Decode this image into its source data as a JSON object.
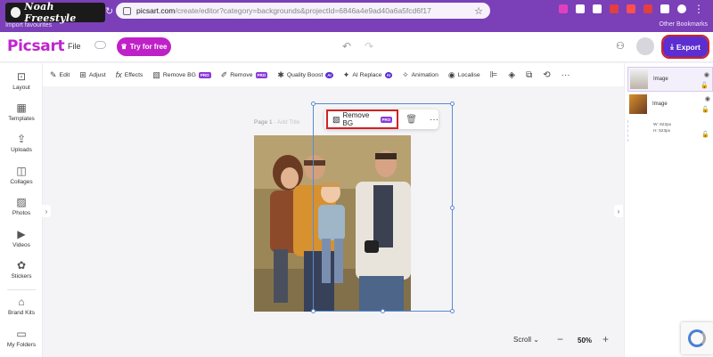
{
  "browser": {
    "brand_logo_text": "Noah Freestyle",
    "import_text": "Import favourites",
    "url_host": "picsart.com",
    "url_path": "/create/editor?category=backgrounds&projectId=6846a4e9ad40a6a5fcd6f17",
    "other_bookmarks": "Other Bookmarks",
    "extension_colors": [
      "#e040c0",
      "#ffffff",
      "#ffffff",
      "#e04040",
      "#ff5050",
      "#e04040",
      "#ffffff",
      "#ffffff"
    ]
  },
  "header": {
    "logo": "Picsart",
    "file_label": "File",
    "try_label": "Try for free",
    "export_label": "Export",
    "accent": "#5b2ed1",
    "brand_pink": "#c020c8"
  },
  "toolbar": {
    "items": [
      {
        "icon": "edit-icon",
        "glyph": "✎",
        "label": "Edit"
      },
      {
        "icon": "adjust-icon",
        "glyph": "⊞",
        "label": "Adjust"
      },
      {
        "icon": "effects-icon",
        "glyph": "fx",
        "label": "Effects"
      },
      {
        "icon": "remove-bg-icon",
        "glyph": "▧",
        "label": "Remove BG",
        "badge": "PRO"
      },
      {
        "icon": "remove-icon",
        "glyph": "✐",
        "label": "Remove",
        "badge": "PRO"
      },
      {
        "icon": "quality-boost-icon",
        "glyph": "✱",
        "label": "Quality Boost",
        "badge": "AI"
      },
      {
        "icon": "ai-replace-icon",
        "glyph": "✦",
        "label": "AI Replace",
        "badge": "AI"
      },
      {
        "icon": "animation-icon",
        "glyph": "✧",
        "label": "Animation"
      },
      {
        "icon": "localize-icon",
        "glyph": "◉",
        "label": "Localise"
      }
    ],
    "extra_icons": [
      {
        "icon": "layers-order-icon",
        "glyph": "⊫"
      },
      {
        "icon": "eraser-icon",
        "glyph": "◈"
      },
      {
        "icon": "crop-icon",
        "glyph": "⧉"
      },
      {
        "icon": "replace-icon",
        "glyph": "⟲"
      },
      {
        "icon": "more-icon",
        "glyph": "···"
      }
    ]
  },
  "sidebar": {
    "items": [
      {
        "icon": "layout-icon",
        "glyph": "⊡",
        "label": "Layout"
      },
      {
        "icon": "templates-icon",
        "glyph": "▦",
        "label": "Templates"
      },
      {
        "icon": "uploads-icon",
        "glyph": "⇪",
        "label": "Uploads"
      },
      {
        "icon": "collages-icon",
        "glyph": "◫",
        "label": "Collages"
      },
      {
        "icon": "photos-icon",
        "glyph": "▨",
        "label": "Photos"
      },
      {
        "icon": "videos-icon",
        "glyph": "▶",
        "label": "Videos"
      },
      {
        "icon": "stickers-icon",
        "glyph": "✿",
        "label": "Stickers"
      },
      {
        "icon": "brand-kits-icon",
        "glyph": "⌂",
        "label": "Brand Kits"
      },
      {
        "icon": "my-folders-icon",
        "glyph": "▭",
        "label": "My Folders"
      }
    ]
  },
  "canvas": {
    "page_label": "Page 1",
    "add_title": "- Add Title",
    "float_remove_label": "Remove BG",
    "float_remove_badge": "PRO"
  },
  "layers": {
    "items": [
      {
        "name": "Image",
        "active": true
      },
      {
        "name": "Image",
        "active": false
      }
    ],
    "width_text": "W: 622px",
    "height_text": "H: 523px"
  },
  "zoom": {
    "mode": "Scroll",
    "value": "50%"
  }
}
